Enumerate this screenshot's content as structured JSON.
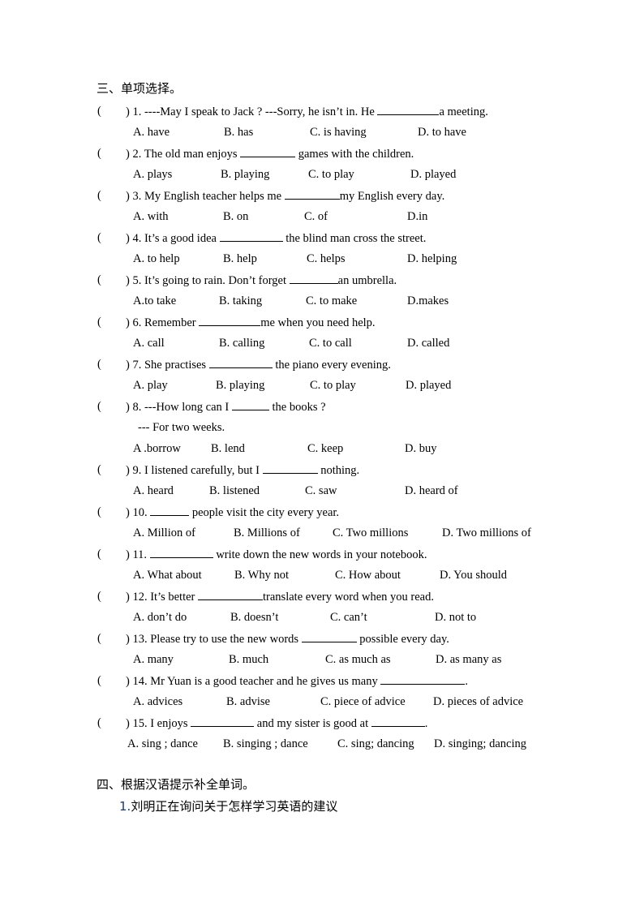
{
  "section3": {
    "title": "三、单项选择。",
    "questions": [
      {
        "num": "1.",
        "parts": [
          "----May I speak to Jack ? ---Sorry, he isn’t in. He ",
          "a meeting."
        ],
        "options": [
          "A. have",
          "B. has",
          "C. is having",
          "D. to have"
        ]
      },
      {
        "num": "2.",
        "parts": [
          "The old man enjoys ",
          " games with the children."
        ],
        "options": [
          "A. plays",
          "B. playing",
          "C. to play",
          "D. played"
        ]
      },
      {
        "num": "3.",
        "parts": [
          "My English teacher helps me ",
          "my English every day."
        ],
        "options": [
          "A. with",
          "B. on",
          "C. of",
          "D.in"
        ]
      },
      {
        "num": "4.",
        "parts": [
          "It’s a good idea ",
          " the blind man cross the street."
        ],
        "options": [
          "A. to help",
          "B. help",
          "C. helps",
          "D. helping"
        ]
      },
      {
        "num": "5.",
        "parts": [
          "It’s going to rain. Don’t forget ",
          "an umbrella."
        ],
        "options": [
          "A.to take",
          "B. taking",
          "C. to make",
          "D.makes"
        ]
      },
      {
        "num": "6.",
        "parts": [
          "Remember ",
          "me when you need help."
        ],
        "options": [
          "A. call",
          "B. calling",
          "C. to call",
          "D. called"
        ]
      },
      {
        "num": "7.",
        "parts": [
          "She practises ",
          " the piano every evening."
        ],
        "options": [
          "A. play",
          "B. playing",
          "C. to play",
          "D. played"
        ]
      },
      {
        "num": "8.",
        "parts": [
          "---How long can I ",
          " the books ?"
        ],
        "extra_line": "--- For two weeks.",
        "options": [
          "A .borrow",
          "B. lend",
          "C. keep",
          "D. buy"
        ]
      },
      {
        "num": "9.",
        "parts": [
          "I listened carefully, but I ",
          " nothing."
        ],
        "options": [
          "A. heard",
          "B. listened",
          "C. saw",
          "D. heard of"
        ]
      },
      {
        "num": "10.",
        "parts": [
          "",
          " people visit the city every year."
        ],
        "options": [
          "A. Million of",
          "B. Millions of",
          "C. Two millions",
          "D. Two millions of"
        ]
      },
      {
        "num": "11.",
        "parts": [
          "",
          " write down the new words in your notebook."
        ],
        "options": [
          "A. What about",
          "B. Why not",
          "C. How about",
          "D. You should"
        ]
      },
      {
        "num": "12.",
        "parts": [
          "It’s better ",
          "translate every word when you read."
        ],
        "options": [
          "A. don’t do",
          "B. doesn’t",
          "C. can’t",
          "D. not to"
        ]
      },
      {
        "num": "13.",
        "parts": [
          "Please try to use the new words ",
          " possible every day."
        ],
        "options": [
          "A. many",
          "B. much",
          "C. as much as",
          "D. as many as"
        ]
      },
      {
        "num": "14.",
        "parts": [
          "Mr Yuan is a good teacher and he gives us many ",
          "."
        ],
        "options": [
          "A. advices",
          "B. advise",
          "C. piece of advice",
          "D. pieces of advice"
        ]
      },
      {
        "num": "15.",
        "parts": [
          "I enjoys ",
          " and my sister is good at ",
          "."
        ],
        "options": [
          "A. sing ; dance",
          "B. singing ; dance",
          "C. sing; dancing",
          "D. singing; dancing"
        ]
      }
    ]
  },
  "section4": {
    "title": "四、根据汉语提示补全单词。",
    "item_num": "1.",
    "item_text": "刘明正在询问关于怎样学习英语的建议"
  },
  "paren_open": "(",
  "paren_close": ")"
}
